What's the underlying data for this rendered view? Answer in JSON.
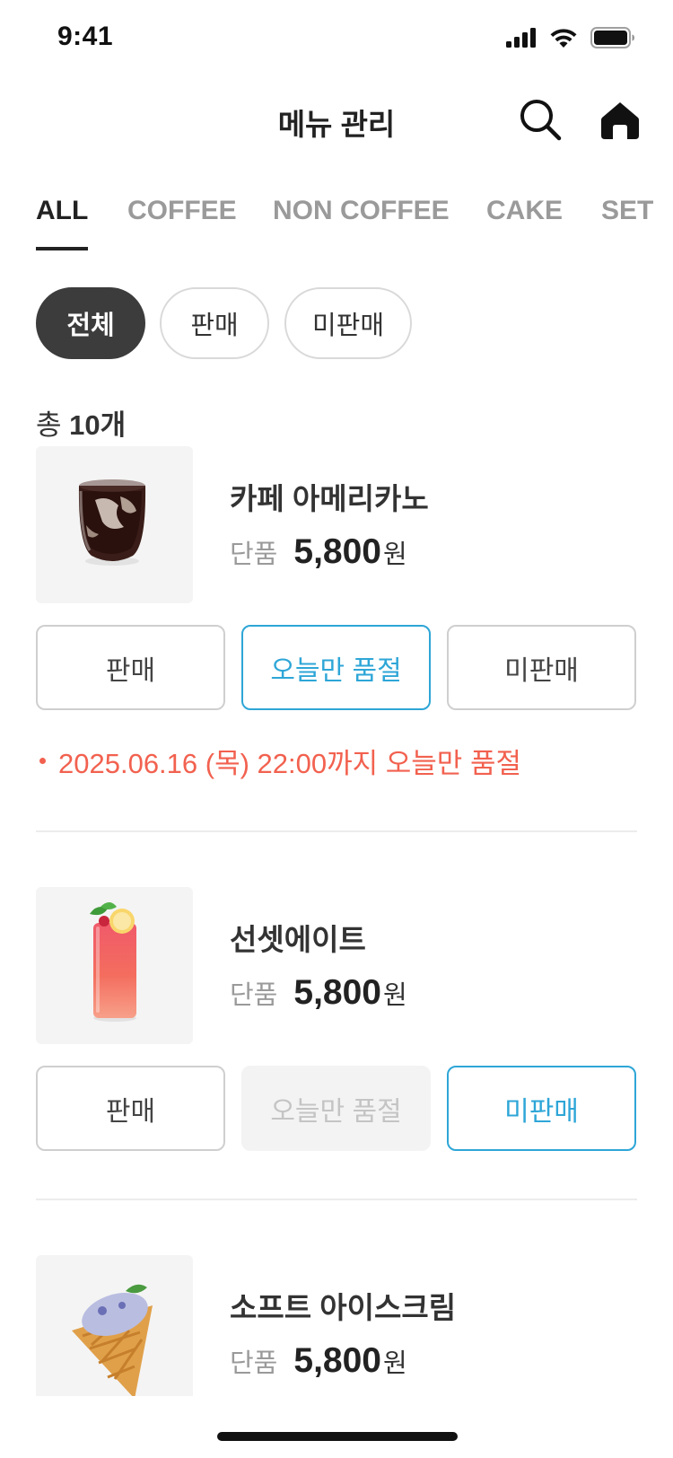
{
  "status_bar": {
    "time": "9:41"
  },
  "header": {
    "title": "메뉴 관리",
    "search_icon": "search-icon",
    "home_icon": "home-icon"
  },
  "tabs": [
    {
      "label": "ALL",
      "active": true
    },
    {
      "label": "COFFEE",
      "active": false
    },
    {
      "label": "NON COFFEE",
      "active": false
    },
    {
      "label": "CAKE",
      "active": false
    },
    {
      "label": "SET",
      "active": false
    }
  ],
  "filters": [
    {
      "label": "전체",
      "active": true
    },
    {
      "label": "판매",
      "active": false
    },
    {
      "label": "미판매",
      "active": false
    }
  ],
  "total": {
    "prefix": "총",
    "count": "10개"
  },
  "items": [
    {
      "name": "카페 아메리카노",
      "type": "단품",
      "price": "5,800",
      "unit": "원",
      "buttons": [
        "판매",
        "오늘만 품절",
        "미판매"
      ],
      "selected": "오늘만 품절",
      "note": "2025.06.16 (목) 22:00까지 오늘만 품절"
    },
    {
      "name": "선셋에이트",
      "type": "단품",
      "price": "5,800",
      "unit": "원",
      "buttons": [
        "판매",
        "오늘만 품절",
        "미판매"
      ],
      "selected": "미판매",
      "disabled": "오늘만 품절"
    },
    {
      "name": "소프트 아이스크림",
      "type": "단품",
      "price": "5,800",
      "unit": "원"
    }
  ],
  "colors": {
    "accent": "#2ea6d7",
    "soldout": "#f2614f",
    "chip_active": "#3c3c3c"
  }
}
